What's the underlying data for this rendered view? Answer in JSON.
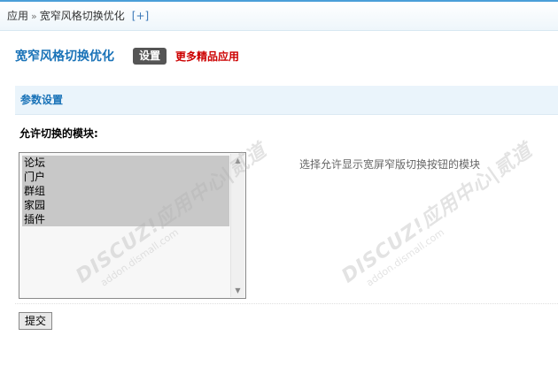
{
  "breadcrumb": {
    "root": "应用",
    "separator": "»",
    "current": "宽窄风格切换优化",
    "add_label": "[+]"
  },
  "header": {
    "title": "宽窄风格切换优化",
    "settings_button": "设置",
    "more_apps_link": "更多精品应用"
  },
  "section": {
    "title": "参数设置"
  },
  "form": {
    "field_label": "允许切换的模块:",
    "options": [
      "论坛",
      "门户",
      "群组",
      "家园",
      "插件"
    ],
    "help_text": "选择允许显示宽屏窄版切换按钮的模块",
    "submit_label": "提交"
  },
  "watermark": {
    "brand": "DISCUZ!应用中心|贰道",
    "domain": "addon.dismall.com"
  },
  "colors": {
    "accent": "#1a73b8",
    "more_apps": "#cc0000",
    "settings_bg": "#555555"
  }
}
